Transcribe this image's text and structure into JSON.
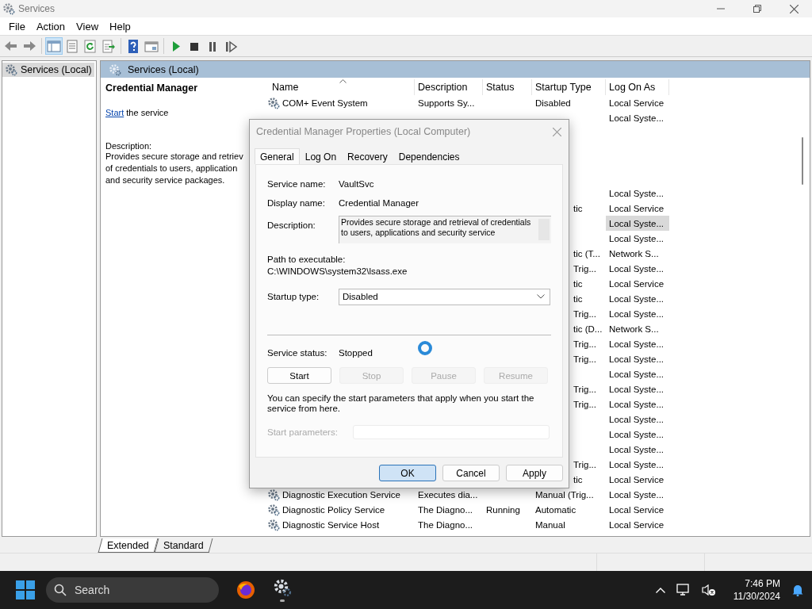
{
  "window": {
    "title": "Services"
  },
  "menu": [
    {
      "label": "File"
    },
    {
      "label": "Action"
    },
    {
      "label": "View"
    },
    {
      "label": "Help"
    }
  ],
  "toolbar": [
    {
      "kind": "back",
      "pressed": false
    },
    {
      "kind": "forward",
      "pressed": false
    },
    {
      "kind": "pane",
      "pressed": true
    },
    {
      "kind": "list",
      "pressed": false
    },
    {
      "kind": "refresh",
      "pressed": false
    },
    {
      "kind": "export",
      "pressed": false
    },
    {
      "kind": "help",
      "pressed": false
    },
    {
      "kind": "window",
      "pressed": false
    },
    {
      "kind": "play",
      "pressed": false
    },
    {
      "kind": "stop",
      "pressed": false
    },
    {
      "kind": "pause",
      "pressed": false
    },
    {
      "kind": "resume",
      "pressed": false
    }
  ],
  "tree": [
    {
      "label": "Services (Local)",
      "selected": true
    }
  ],
  "panel": {
    "title": "Services (Local)"
  },
  "detail": {
    "title": "Credential Manager",
    "action_link": "Start",
    "action_text": "the service",
    "description_label": "Description:",
    "description_lines": [
      "Provides secure storage and retriev",
      "of credentials to users, application",
      "and security service packages."
    ]
  },
  "table": {
    "columns": [
      {
        "label": "Name",
        "sorted": true
      },
      {
        "label": "Description",
        "sorted": false
      },
      {
        "label": "Status",
        "sorted": false
      },
      {
        "label": "Startup Type",
        "sorted": false
      },
      {
        "label": "Log On As",
        "sorted": false
      }
    ],
    "rows": [
      {
        "name": "COM+ Event System",
        "description": "Supports Sy...",
        "startup": "Disabled",
        "log_on": "Local Service",
        "selected": false
      },
      {
        "log_on": "Local Syste...",
        "selected": false
      },
      {
        "selected": false
      },
      {
        "selected": false
      },
      {
        "selected": false
      },
      {
        "selected": false
      },
      {
        "log_on": "Local Syste...",
        "selected": false
      },
      {
        "startup": "tic",
        "startup_cut": true,
        "log_on": "Local Service",
        "selected": false
      },
      {
        "log_on": "Local Syste...",
        "selected": true
      },
      {
        "log_on": "Local Syste...",
        "selected": false
      },
      {
        "startup": "tic (T...",
        "startup_cut": true,
        "log_on": "Network S...",
        "selected": false
      },
      {
        "startup": "Trig...",
        "startup_cut": true,
        "log_on": "Local Syste...",
        "selected": false
      },
      {
        "startup": "tic",
        "startup_cut": true,
        "log_on": "Local Service",
        "selected": false
      },
      {
        "startup": "tic",
        "startup_cut": true,
        "log_on": "Local Syste...",
        "selected": false
      },
      {
        "startup": "Trig...",
        "startup_cut": true,
        "log_on": "Local Syste...",
        "selected": false
      },
      {
        "startup": "tic (D...",
        "startup_cut": true,
        "log_on": "Network S...",
        "selected": false
      },
      {
        "startup": "Trig...",
        "startup_cut": true,
        "log_on": "Local Syste...",
        "selected": false
      },
      {
        "startup": "Trig...",
        "startup_cut": true,
        "log_on": "Local Syste...",
        "selected": false
      },
      {
        "log_on": "Local Syste...",
        "selected": false
      },
      {
        "startup": "Trig...",
        "startup_cut": true,
        "log_on": "Local Syste...",
        "selected": false
      },
      {
        "startup": "Trig...",
        "startup_cut": true,
        "log_on": "Local Syste...",
        "selected": false
      },
      {
        "log_on": "Local Syste...",
        "selected": false
      },
      {
        "log_on": "Local Syste...",
        "selected": false
      },
      {
        "log_on": "Local Syste...",
        "selected": false
      },
      {
        "startup": "Trig...",
        "startup_cut": true,
        "log_on": "Local Syste...",
        "selected": false
      },
      {
        "startup": "tic",
        "startup_cut": true,
        "log_on": "Local Service",
        "selected": false
      },
      {
        "name": "Diagnostic Execution Service",
        "description": "Executes dia...",
        "startup": "Manual (Trig...",
        "log_on": "Local Syste...",
        "selected": false
      },
      {
        "name": "Diagnostic Policy Service",
        "description": "The Diagno...",
        "status": "Running",
        "startup": "Automatic",
        "log_on": "Local Service",
        "selected": false
      },
      {
        "name": "Diagnostic Service Host",
        "description": "The Diagno...",
        "startup": "Manual",
        "log_on": "Local Service",
        "selected": false
      }
    ]
  },
  "view_tabs": [
    {
      "label": "Extended",
      "selected": true
    },
    {
      "label": "Standard",
      "selected": false
    }
  ],
  "dialog": {
    "title": "Credential Manager Properties (Local Computer)",
    "tabs": [
      {
        "label": "General",
        "selected": true
      },
      {
        "label": "Log On",
        "selected": false
      },
      {
        "label": "Recovery",
        "selected": false
      },
      {
        "label": "Dependencies",
        "selected": false
      }
    ],
    "service_name_label": "Service name:",
    "service_name": "VaultSvc",
    "display_name_label": "Display name:",
    "display_name": "Credential Manager",
    "description_label": "Description:",
    "description_lines": [
      "Provides secure storage and retrieval of credentials",
      "to users, applications and security service"
    ],
    "path_label": "Path to executable:",
    "path": "C:\\WINDOWS\\system32\\lsass.exe",
    "startup_label": "Startup type:",
    "startup_value": "Disabled",
    "status_label": "Service status:",
    "status_value": "Stopped",
    "service_buttons": [
      {
        "label": "Start",
        "disabled": false
      },
      {
        "label": "Stop",
        "disabled": true
      },
      {
        "label": "Pause",
        "disabled": true
      },
      {
        "label": "Resume",
        "disabled": true
      }
    ],
    "note": "You can specify the start parameters that apply when you start the service from here.",
    "params_label": "Start parameters:",
    "params_disabled": true,
    "buttons": [
      {
        "label": "OK",
        "default": true
      },
      {
        "label": "Cancel",
        "default": false
      },
      {
        "label": "Apply",
        "default": false
      }
    ]
  },
  "taskbar": {
    "search_placeholder": "Search",
    "time": "7:46 PM",
    "date": "11/30/2024"
  }
}
